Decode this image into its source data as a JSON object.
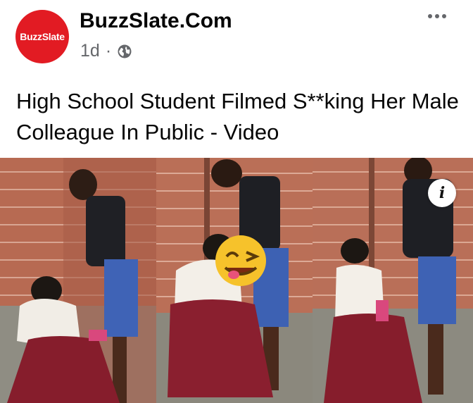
{
  "post": {
    "page_name": "BuzzSlate.Com",
    "avatar_text": "BuzzSlate",
    "timestamp": "1d",
    "separator": "·",
    "privacy_icon": "globe-icon",
    "more_icon": "more-options-icon",
    "headline": "High School Student Filmed S**king Her Male Colleague In Public - Video"
  },
  "media": {
    "info_label": "i",
    "info_icon": "info-icon",
    "frames": 3,
    "sticker_icon": "winking-face-icon"
  },
  "colors": {
    "brand": "#e21b23",
    "text_primary": "#050505",
    "text_secondary": "#65676b"
  }
}
